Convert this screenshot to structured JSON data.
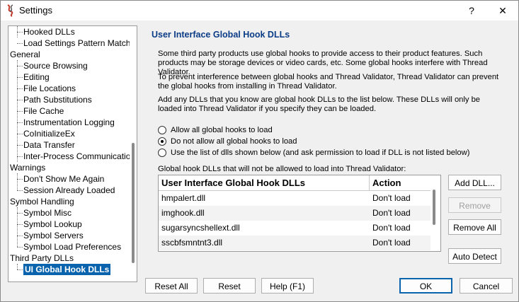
{
  "window": {
    "title": "Settings",
    "help_glyph": "?",
    "close_glyph": "✕"
  },
  "tree": {
    "items": [
      {
        "label": "Hooked DLLs",
        "level": 1
      },
      {
        "label": "Load Settings Pattern Match",
        "level": 1
      },
      {
        "label": "General",
        "level": 0
      },
      {
        "label": "Source Browsing",
        "level": 1
      },
      {
        "label": "Editing",
        "level": 1
      },
      {
        "label": "File Locations",
        "level": 1
      },
      {
        "label": "Path Substitutions",
        "level": 1
      },
      {
        "label": "File Cache",
        "level": 1
      },
      {
        "label": "Instrumentation Logging",
        "level": 1
      },
      {
        "label": "CoInitializeEx",
        "level": 1
      },
      {
        "label": "Data Transfer",
        "level": 1
      },
      {
        "label": "Inter-Process Communication",
        "level": 1
      },
      {
        "label": "Warnings",
        "level": 0
      },
      {
        "label": "Don't Show Me Again",
        "level": 1
      },
      {
        "label": "Session Already Loaded",
        "level": 1
      },
      {
        "label": "Symbol Handling",
        "level": 0
      },
      {
        "label": "Symbol Misc",
        "level": 1
      },
      {
        "label": "Symbol Lookup",
        "level": 1
      },
      {
        "label": "Symbol Servers",
        "level": 1
      },
      {
        "label": "Symbol Load Preferences",
        "level": 1
      },
      {
        "label": "Third Party DLLs",
        "level": 0
      },
      {
        "label": "UI Global Hook DLLs",
        "level": 1,
        "selected": true
      }
    ]
  },
  "panel": {
    "title": "User Interface Global Hook DLLs",
    "paragraphs": [
      "Some third party products use global hooks to provide access to their product features. Such products may be storage devices or video cards, etc. Some global hooks interfere with Thread Validator.",
      "To prevent interference between global hooks and Thread Validator, Thread Validator can prevent the global hooks from installing in Thread Validator.",
      "Add any DLLs that you know are global hook DLLs to the list below. These DLLs will only be loaded into Thread Validator if you specify they can be loaded."
    ],
    "radios": [
      {
        "label": "Allow all global hooks to load",
        "checked": false
      },
      {
        "label": "Do not allow all global hooks to load",
        "checked": true
      },
      {
        "label": "Use the list of dlls shown below (and ask permission to load if DLL is not listed below)",
        "checked": false
      }
    ],
    "list_caption": "Global hook DLLs that will not be allowed to load into Thread Validator:",
    "list": {
      "columns": [
        "User Interface Global Hook DLLs",
        "Action"
      ],
      "rows": [
        {
          "dll": "hmpalert.dll",
          "action": "Don't load"
        },
        {
          "dll": "imghook.dll",
          "action": "Don't load"
        },
        {
          "dll": "sugarsyncshellext.dll",
          "action": "Don't load"
        },
        {
          "dll": "sscbfsmntnt3.dll",
          "action": "Don't load"
        }
      ]
    },
    "side_buttons": {
      "add": "Add DLL...",
      "remove": "Remove",
      "remove_all": "Remove All",
      "auto_detect": "Auto Detect"
    }
  },
  "footer": {
    "reset_all": "Reset All",
    "reset": "Reset",
    "help": "Help (F1)",
    "ok": "OK",
    "cancel": "Cancel"
  }
}
